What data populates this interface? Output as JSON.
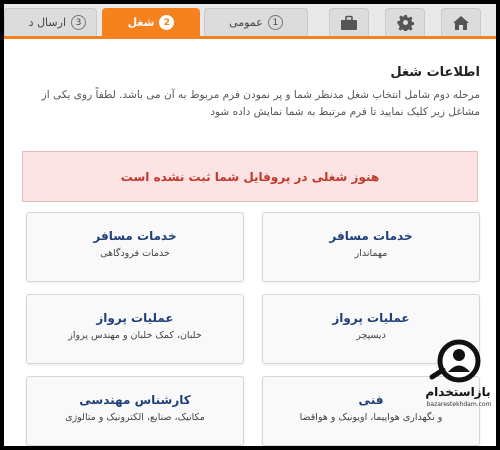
{
  "tabs": [
    {
      "label": "",
      "icon": "home-icon"
    },
    {
      "label": "",
      "icon": "gear-icon"
    },
    {
      "label": "",
      "icon": "briefcase-icon"
    },
    {
      "label": "عمومی",
      "num": "1"
    },
    {
      "label": "شغل",
      "num": "2"
    },
    {
      "label": "ارسال د",
      "num": "3"
    }
  ],
  "section": {
    "title": "اطلاعات شغل",
    "description": "مرحله دوم شامل انتخاب شغل مدنظر شما و پر نمودن فرم مربوط به آن می باشد. لطفاً روی یکی از مشاغل زیر کلیک نمایید تا فرم مرتبط به شما نمایش داده شود"
  },
  "alert": "هنوز شغلی در پروفایل شما ثبت نشده است",
  "jobs": [
    {
      "title": "خدمات مسافر",
      "subtitle": "مهماندار"
    },
    {
      "title": "خدمات مسافر",
      "subtitle": "خدمات فرودگاهی"
    },
    {
      "title": "عملیات پرواز",
      "subtitle": "دیسپچر"
    },
    {
      "title": "عملیات پرواز",
      "subtitle": "خلبان، کمک خلبان و مهندس پرواز"
    },
    {
      "title": "فنی",
      "subtitle": "و نگهداری هواپیما، اویونیک و هواقضا"
    },
    {
      "title": "کارشناس مهندسی",
      "subtitle": "مکانیک، صنایع، الکترونیک و متالوژی"
    }
  ],
  "watermark": {
    "text": "بازاستخدام",
    "url": "bazarestekhdam.com"
  },
  "colors": {
    "accent": "#f5821f",
    "alert_text": "#c0392b",
    "job_title": "#1f3f7a"
  }
}
